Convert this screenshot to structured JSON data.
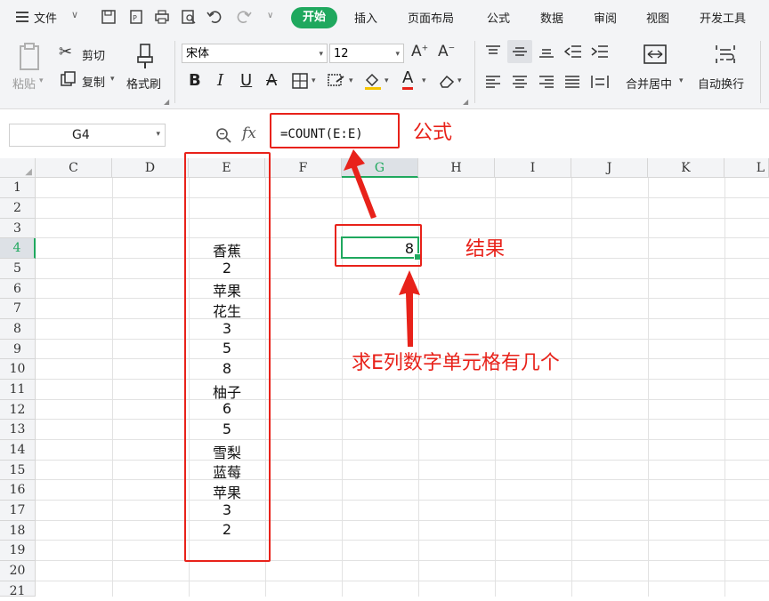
{
  "menu": {
    "file_label": "文件",
    "tabs": [
      "开始",
      "插入",
      "页面布局",
      "公式",
      "数据",
      "审阅",
      "视图",
      "开发工具"
    ]
  },
  "ribbon": {
    "paste_label": "粘贴",
    "cut_label": "剪切",
    "copy_label": "复制",
    "format_painter_label": "格式刷",
    "font_name": "宋体",
    "font_size": "12",
    "merge_center_label": "合并居中",
    "wrap_text_label": "自动换行"
  },
  "formula_bar": {
    "name_box": "G4",
    "fx_label": "fx",
    "formula": "=COUNT(E:E)"
  },
  "grid": {
    "columns": [
      "C",
      "D",
      "E",
      "F",
      "G",
      "H",
      "I",
      "J",
      "K",
      "L"
    ],
    "rows": [
      "1",
      "2",
      "3",
      "4",
      "5",
      "6",
      "7",
      "8",
      "9",
      "10",
      "11",
      "12",
      "13",
      "14",
      "15",
      "16",
      "17",
      "18",
      "19",
      "20",
      "21"
    ],
    "column_e": [
      "",
      "",
      "",
      "香蕉",
      "2",
      "苹果",
      "花生",
      "3",
      "5",
      "8",
      "柚子",
      "6",
      "5",
      "雪梨",
      "蓝莓",
      "苹果",
      "3",
      "2",
      "",
      "",
      ""
    ],
    "selected_cell": "G4",
    "g4_value": "8"
  },
  "annotations": {
    "formula_label": "公式",
    "result_label": "结果",
    "description": "求E列数字单元格有几个"
  },
  "colors": {
    "accent_green": "#1fa85e",
    "annotation_red": "#e8221a"
  }
}
